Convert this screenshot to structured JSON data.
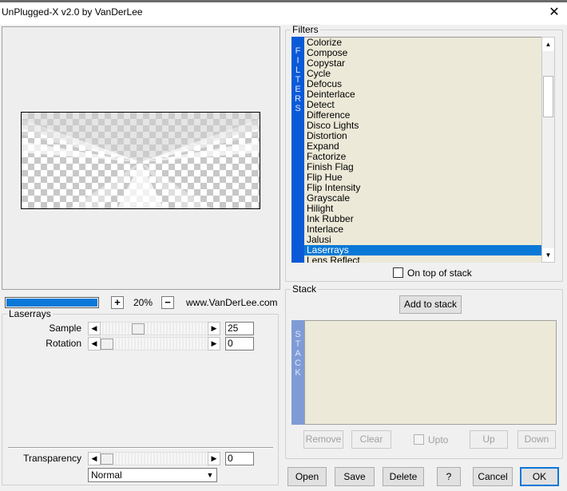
{
  "window": {
    "title": "UnPlugged-X v2.0 by VanDerLee",
    "close_glyph": "✕"
  },
  "preview": {
    "zoom_progress": 1.0,
    "zoom_plus": "+",
    "zoom_value": "20%",
    "zoom_minus": "−",
    "site_url": "www.VanDerLee.com"
  },
  "filter_params": {
    "group_title": "Laserrays",
    "sample": {
      "label": "Sample",
      "value": "25",
      "fraction": 0.33
    },
    "rotation": {
      "label": "Rotation",
      "value": "0",
      "fraction": 0.0
    },
    "transparency": {
      "label": "Transparency",
      "value": "0",
      "fraction": 0.0
    },
    "blend_mode": "Normal"
  },
  "filters": {
    "group_title": "Filters",
    "side_letters": [
      "F",
      "I",
      "L",
      "T",
      "E",
      "R",
      "S"
    ],
    "items": [
      "Colorize",
      "Compose",
      "Copystar",
      "Cycle",
      "Defocus",
      "Deinterlace",
      "Detect",
      "Difference",
      "Disco Lights",
      "Distortion",
      "Expand",
      "Factorize",
      "Finish Flag",
      "Flip Hue",
      "Flip Intensity",
      "Grayscale",
      "Hilight",
      "Ink Rubber",
      "Interlace",
      "Jalusi",
      "Laserrays",
      "Lens Reflect"
    ],
    "selected": "Laserrays",
    "on_top_label": "On top of stack"
  },
  "stack": {
    "group_title": "Stack",
    "add_label": "Add to stack",
    "side_letters": [
      "S",
      "T",
      "A",
      "C",
      "K"
    ],
    "remove_label": "Remove",
    "clear_label": "Clear",
    "upto_label": "Upto",
    "up_label": "Up",
    "down_label": "Down"
  },
  "buttons": {
    "open": "Open",
    "save": "Save",
    "delete": "Delete",
    "help": "?",
    "cancel": "Cancel",
    "ok": "OK"
  }
}
